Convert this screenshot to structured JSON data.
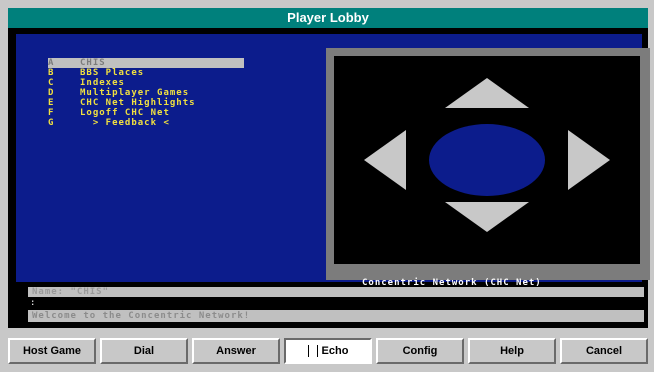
{
  "window": {
    "title": "Player Lobby"
  },
  "menu": {
    "items": [
      {
        "key": "A",
        "label": "CHIS",
        "selected": true
      },
      {
        "key": "B",
        "label": "BBS Places",
        "selected": false
      },
      {
        "key": "C",
        "label": "Indexes",
        "selected": false
      },
      {
        "key": "D",
        "label": "Multiplayer Games",
        "selected": false
      },
      {
        "key": "E",
        "label": "CHC Net Highlights",
        "selected": false
      },
      {
        "key": "F",
        "label": "Logoff CHC Net",
        "selected": false
      },
      {
        "key": "G",
        "label": "  > Feedback <",
        "selected": false
      }
    ]
  },
  "network_label": "Concentric Network (CHC Net)",
  "status": {
    "name_line": "Name: \"CHIS\"",
    "prompt": ":",
    "welcome_line": "Welcome to the Concentric Network!"
  },
  "buttons": [
    {
      "id": "host-game",
      "label": "Host Game"
    },
    {
      "id": "dial",
      "label": "Dial"
    },
    {
      "id": "answer",
      "label": "Answer"
    },
    {
      "id": "echo",
      "label": "Echo",
      "pressed": true
    },
    {
      "id": "config",
      "label": "Config"
    },
    {
      "id": "help",
      "label": "Help"
    },
    {
      "id": "cancel",
      "label": "Cancel"
    }
  ],
  "colors": {
    "title_bar": "#00807c",
    "panel_blue": "#0c1c8c",
    "menu_text": "#f0e040",
    "arrow_gray": "#c8c8c8",
    "center_oval": "#0c1c8c"
  }
}
